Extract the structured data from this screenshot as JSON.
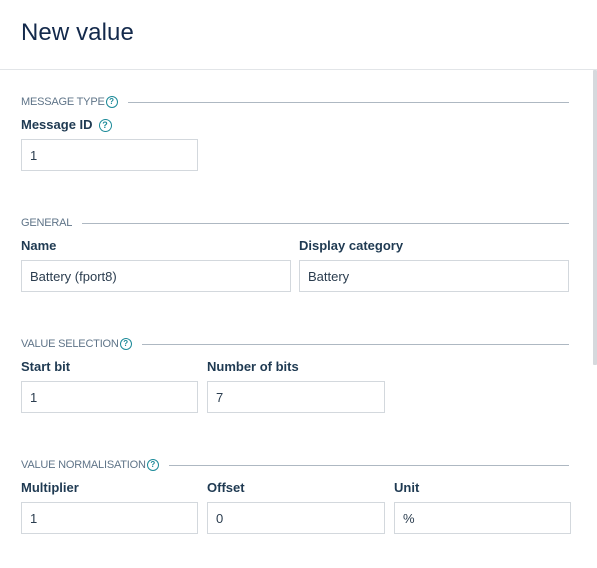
{
  "header": {
    "title": "New value"
  },
  "sections": {
    "message_type": {
      "title": "MESSAGE TYPE",
      "help_icon": "question-circle-icon",
      "fields": {
        "message_id": {
          "label": "Message ID",
          "value": "1",
          "help_icon": "question-circle-icon"
        }
      }
    },
    "general": {
      "title": "GENERAL",
      "fields": {
        "name": {
          "label": "Name",
          "value": "Battery (fport8)"
        },
        "display_category": {
          "label": "Display category",
          "value": "Battery"
        }
      }
    },
    "value_selection": {
      "title": "VALUE SELECTION",
      "help_icon": "question-circle-icon",
      "fields": {
        "start_bit": {
          "label": "Start bit",
          "value": "1"
        },
        "number_of_bits": {
          "label": "Number of bits",
          "value": "7"
        }
      }
    },
    "value_normalisation": {
      "title": "VALUE NORMALISATION",
      "help_icon": "question-circle-icon",
      "fields": {
        "multiplier": {
          "label": "Multiplier",
          "value": "1"
        },
        "offset": {
          "label": "Offset",
          "value": "0"
        },
        "unit": {
          "label": "Unit",
          "value": "%"
        }
      }
    }
  },
  "icons": {
    "help_glyph": "?"
  }
}
